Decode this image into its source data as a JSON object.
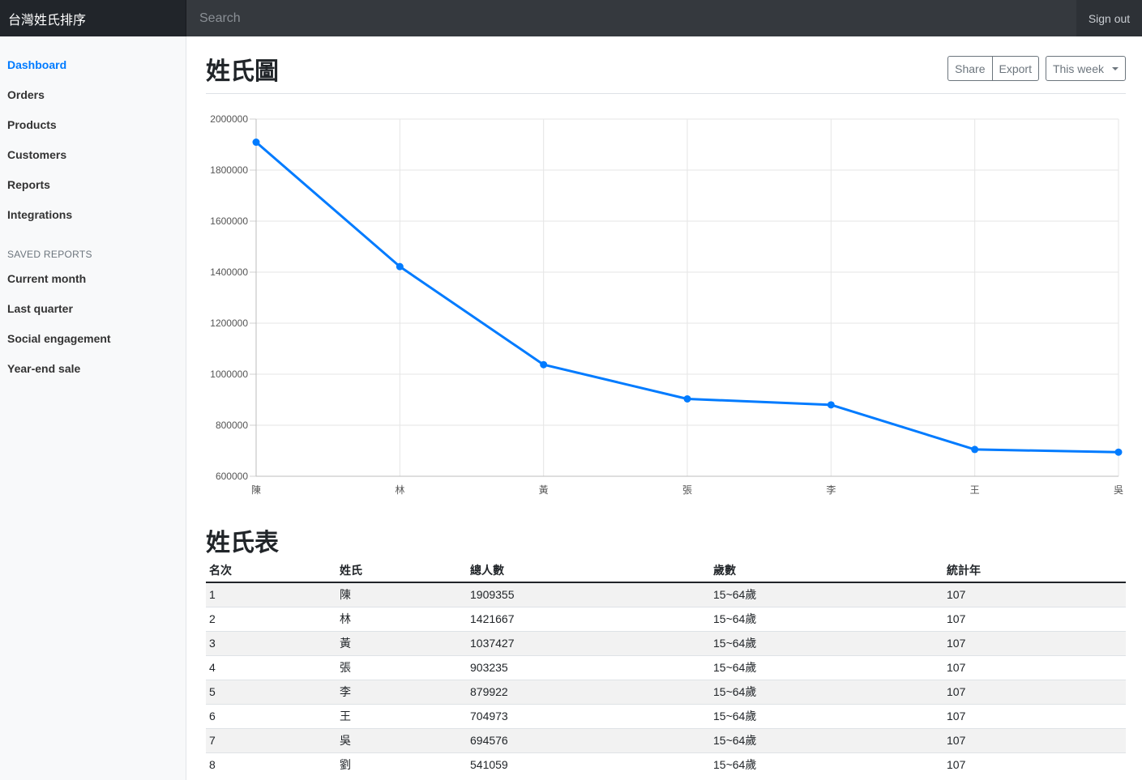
{
  "navbar": {
    "brand": "台灣姓氏排序",
    "search_placeholder": "Search",
    "signout_label": "Sign out"
  },
  "sidebar": {
    "items": [
      {
        "label": "Dashboard",
        "active": true
      },
      {
        "label": "Orders"
      },
      {
        "label": "Products"
      },
      {
        "label": "Customers"
      },
      {
        "label": "Reports"
      },
      {
        "label": "Integrations"
      }
    ],
    "saved_heading": "SAVED REPORTS",
    "saved_items": [
      {
        "label": "Current month"
      },
      {
        "label": "Last quarter"
      },
      {
        "label": "Social engagement"
      },
      {
        "label": "Year-end sale"
      }
    ]
  },
  "main": {
    "chart_title": "姓氏圖",
    "share_label": "Share",
    "export_label": "Export",
    "period_label": "This week",
    "table_title": "姓氏表"
  },
  "chart_data": {
    "type": "line",
    "categories": [
      "陳",
      "林",
      "黃",
      "張",
      "李",
      "王",
      "吳"
    ],
    "series": [
      {
        "values": [
          1909355,
          1421667,
          1037427,
          903235,
          879922,
          704973,
          694576
        ],
        "color": "#007bff"
      }
    ],
    "yticks": [
      600000,
      800000,
      1000000,
      1200000,
      1400000,
      1600000,
      1800000,
      2000000
    ],
    "ylim": [
      600000,
      2000000
    ],
    "grid": true
  },
  "table": {
    "headers": [
      "名次",
      "姓氏",
      "總人數",
      "歲數",
      "統計年"
    ],
    "rows": [
      [
        "1",
        "陳",
        "1909355",
        "15~64歲",
        "107"
      ],
      [
        "2",
        "林",
        "1421667",
        "15~64歲",
        "107"
      ],
      [
        "3",
        "黃",
        "1037427",
        "15~64歲",
        "107"
      ],
      [
        "4",
        "張",
        "903235",
        "15~64歲",
        "107"
      ],
      [
        "5",
        "李",
        "879922",
        "15~64歲",
        "107"
      ],
      [
        "6",
        "王",
        "704973",
        "15~64歲",
        "107"
      ],
      [
        "7",
        "吳",
        "694576",
        "15~64歲",
        "107"
      ],
      [
        "8",
        "劉",
        "541059",
        "15~64歲",
        "107"
      ]
    ]
  }
}
